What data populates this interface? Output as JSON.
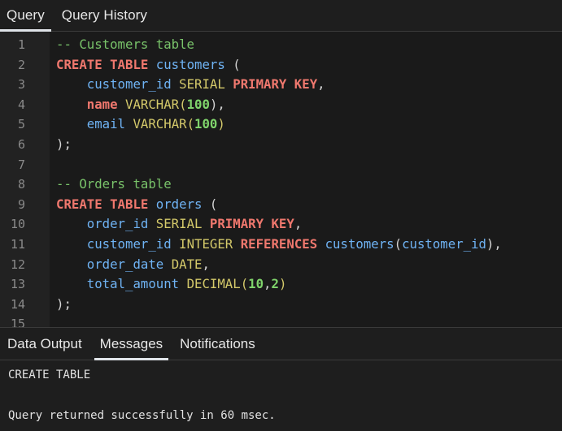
{
  "tabs": [
    {
      "label": "Query",
      "active": true
    },
    {
      "label": "Query History",
      "active": false
    }
  ],
  "editor": {
    "lines": [
      {
        "n": "1",
        "tokens": [
          {
            "t": "-- Customers table",
            "c": "cm"
          }
        ]
      },
      {
        "n": "2",
        "tokens": [
          {
            "t": "CREATE TABLE",
            "c": "kw"
          },
          {
            "t": " ",
            "c": "pu"
          },
          {
            "t": "customers",
            "c": "id"
          },
          {
            "t": " (",
            "c": "pu"
          }
        ]
      },
      {
        "n": "3",
        "tokens": [
          {
            "t": "    customer_id",
            "c": "id"
          },
          {
            "t": " ",
            "c": "pu"
          },
          {
            "t": "SERIAL",
            "c": "ty"
          },
          {
            "t": " ",
            "c": "pu"
          },
          {
            "t": "PRIMARY KEY",
            "c": "kw"
          },
          {
            "t": ",",
            "c": "pu"
          }
        ]
      },
      {
        "n": "4",
        "tokens": [
          {
            "t": "    ",
            "c": "pu"
          },
          {
            "t": "name",
            "c": "kw"
          },
          {
            "t": " ",
            "c": "pu"
          },
          {
            "t": "VARCHAR",
            "c": "ty"
          },
          {
            "t": "(",
            "c": "ty"
          },
          {
            "t": "100",
            "c": "num"
          },
          {
            "t": "),",
            "c": "pu"
          }
        ]
      },
      {
        "n": "5",
        "tokens": [
          {
            "t": "    email",
            "c": "id"
          },
          {
            "t": " ",
            "c": "pu"
          },
          {
            "t": "VARCHAR",
            "c": "ty"
          },
          {
            "t": "(",
            "c": "ty"
          },
          {
            "t": "100",
            "c": "num"
          },
          {
            "t": ")",
            "c": "ty"
          }
        ]
      },
      {
        "n": "6",
        "tokens": [
          {
            "t": ");",
            "c": "pu"
          }
        ]
      },
      {
        "n": "7",
        "tokens": []
      },
      {
        "n": "8",
        "tokens": [
          {
            "t": "-- Orders table",
            "c": "cm"
          }
        ]
      },
      {
        "n": "9",
        "tokens": [
          {
            "t": "CREATE TABLE",
            "c": "kw"
          },
          {
            "t": " ",
            "c": "pu"
          },
          {
            "t": "orders",
            "c": "id"
          },
          {
            "t": " (",
            "c": "pu"
          }
        ]
      },
      {
        "n": "10",
        "tokens": [
          {
            "t": "    order_id",
            "c": "id"
          },
          {
            "t": " ",
            "c": "pu"
          },
          {
            "t": "SERIAL",
            "c": "ty"
          },
          {
            "t": " ",
            "c": "pu"
          },
          {
            "t": "PRIMARY KEY",
            "c": "kw"
          },
          {
            "t": ",",
            "c": "pu"
          }
        ]
      },
      {
        "n": "11",
        "tokens": [
          {
            "t": "    customer_id",
            "c": "id"
          },
          {
            "t": " ",
            "c": "pu"
          },
          {
            "t": "INTEGER",
            "c": "ty"
          },
          {
            "t": " ",
            "c": "pu"
          },
          {
            "t": "REFERENCES",
            "c": "kw"
          },
          {
            "t": " ",
            "c": "pu"
          },
          {
            "t": "customers",
            "c": "id"
          },
          {
            "t": "(",
            "c": "pu"
          },
          {
            "t": "customer_id",
            "c": "id"
          },
          {
            "t": "),",
            "c": "pu"
          }
        ]
      },
      {
        "n": "12",
        "tokens": [
          {
            "t": "    order_date",
            "c": "id"
          },
          {
            "t": " ",
            "c": "pu"
          },
          {
            "t": "DATE",
            "c": "ty"
          },
          {
            "t": ",",
            "c": "pu"
          }
        ]
      },
      {
        "n": "13",
        "tokens": [
          {
            "t": "    total_amount",
            "c": "id"
          },
          {
            "t": " ",
            "c": "pu"
          },
          {
            "t": "DECIMAL",
            "c": "ty"
          },
          {
            "t": "(",
            "c": "ty"
          },
          {
            "t": "10",
            "c": "num"
          },
          {
            "t": ",",
            "c": "pu"
          },
          {
            "t": "2",
            "c": "num"
          },
          {
            "t": ")",
            "c": "ty"
          }
        ]
      },
      {
        "n": "14",
        "tokens": [
          {
            "t": ");",
            "c": "pu"
          }
        ]
      },
      {
        "n": "15",
        "tokens": []
      }
    ]
  },
  "output_tabs": [
    {
      "label": "Data Output",
      "active": false
    },
    {
      "label": "Messages",
      "active": true
    },
    {
      "label": "Notifications",
      "active": false
    }
  ],
  "messages": {
    "line1": "CREATE TABLE",
    "line2": "Query returned successfully in 60 msec."
  },
  "colors": {
    "background": "#1e1e1e",
    "keyword": "#f0786e",
    "type": "#d4c96a",
    "identifier": "#6fb3f4",
    "number": "#7fd36b",
    "comment": "#79c36a"
  }
}
